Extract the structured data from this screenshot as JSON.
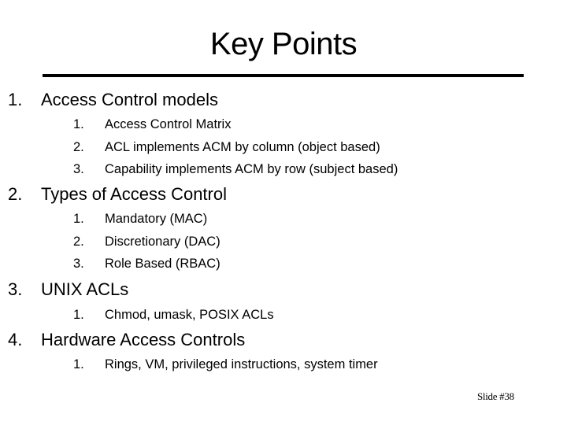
{
  "slide": {
    "title": "Key Points",
    "sections": [
      {
        "number": "1.",
        "heading": "Access Control models",
        "items": [
          {
            "number": "1.",
            "text": "Access Control Matrix"
          },
          {
            "number": "2.",
            "text": "ACL implements ACM by column (object based)"
          },
          {
            "number": "3.",
            "text": "Capability implements ACM by row (subject based)"
          }
        ]
      },
      {
        "number": "2.",
        "heading": "Types of Access Control",
        "items": [
          {
            "number": "1.",
            "text": "Mandatory (MAC)"
          },
          {
            "number": "2.",
            "text": "Discretionary (DAC)"
          },
          {
            "number": "3.",
            "text": "Role Based (RBAC)"
          }
        ]
      },
      {
        "number": "3.",
        "heading": "UNIX ACLs",
        "items": [
          {
            "number": "1.",
            "text": "Chmod, umask, POSIX ACLs"
          }
        ]
      },
      {
        "number": "4.",
        "heading": "Hardware Access Controls",
        "items": [
          {
            "number": "1.",
            "text": "Rings, VM, privileged instructions, system timer"
          }
        ]
      }
    ],
    "footer": "Slide #38"
  }
}
